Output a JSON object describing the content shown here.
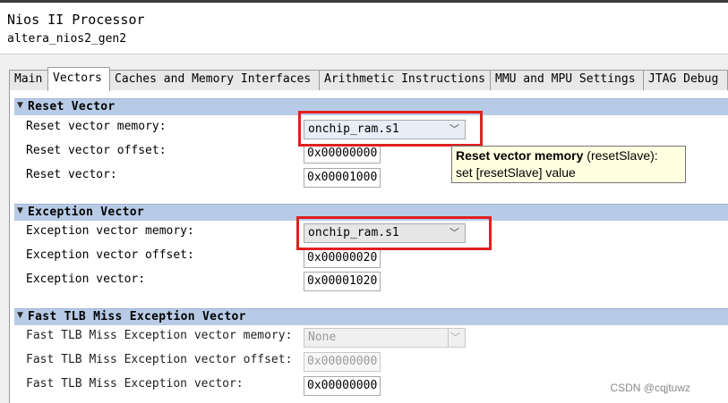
{
  "header": {
    "title": "Nios II Processor",
    "subtitle": "altera_nios2_gen2"
  },
  "tabs": [
    {
      "label": "Main"
    },
    {
      "label": "Vectors"
    },
    {
      "label": "Caches and Memory Interfaces"
    },
    {
      "label": "Arithmetic Instructions"
    },
    {
      "label": "MMU and MPU Settings"
    },
    {
      "label": "JTAG Debug"
    }
  ],
  "active_tab": "Vectors",
  "reset": {
    "title": "Reset Vector",
    "memory_label": "Reset vector memory:",
    "memory_value": "onchip_ram.s1",
    "offset_label": "Reset vector offset:",
    "offset_value": "0x00000000",
    "vector_label": "Reset vector:",
    "vector_value": "0x00001000"
  },
  "tooltip": {
    "bold": "Reset vector memory",
    "normal": " (resetSlave):",
    "line2": "set [resetSlave] value"
  },
  "exception": {
    "title": "Exception Vector",
    "memory_label": "Exception vector memory:",
    "memory_value": "onchip_ram.s1",
    "offset_label": "Exception vector offset:",
    "offset_value": "0x00000020",
    "vector_label": "Exception vector:",
    "vector_value": "0x00001020"
  },
  "tlb": {
    "title": "Fast TLB Miss Exception Vector",
    "memory_label": "Fast TLB Miss Exception vector memory:",
    "memory_value": "None",
    "offset_label": "Fast TLB Miss Exception vector offset:",
    "offset_value": "0x00000000",
    "vector_label": "Fast TLB Miss Exception vector:",
    "vector_value": "0x00000000"
  },
  "watermark": "CSDN @cqjtuwz",
  "colors": {
    "section_bar": "#b8cbe6",
    "highlight": "#e02020",
    "tooltip_bg": "#ffffe1"
  }
}
